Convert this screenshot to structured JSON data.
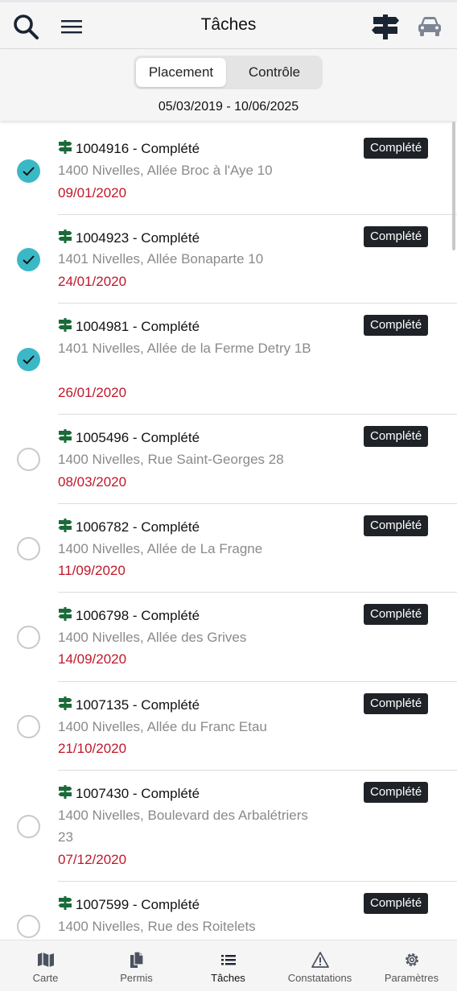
{
  "header": {
    "title": "Tâches"
  },
  "segment": {
    "options": [
      "Placement",
      "Contrôle"
    ],
    "selected": "Placement"
  },
  "date_range": "05/03/2019 - 10/06/2025",
  "tasks": [
    {
      "title": "1004916 - Complété",
      "address": "1400 Nivelles, Allée Broc à l'Aye 10",
      "date": "09/01/2020",
      "badge": "Complété",
      "checked": true
    },
    {
      "title": "1004923 - Complété",
      "address": "1401 Nivelles, Allée Bonaparte 10",
      "date": "24/01/2020",
      "badge": "Complété",
      "checked": true
    },
    {
      "title": "1004981 - Complété",
      "address": "1401 Nivelles, Allée de la Ferme Detry 1B",
      "date": "26/01/2020",
      "badge": "Complété",
      "checked": true
    },
    {
      "title": "1005496 - Complété",
      "address": "1400 Nivelles, Rue Saint-Georges 28",
      "date": "08/03/2020",
      "badge": "Complété",
      "checked": false
    },
    {
      "title": "1006782 - Complété",
      "address": "1400 Nivelles, Allée de La Fragne",
      "date": "11/09/2020",
      "badge": "Complété",
      "checked": false
    },
    {
      "title": "1006798 - Complété",
      "address": "1400 Nivelles, Allée des Grives",
      "date": "14/09/2020",
      "badge": "Complété",
      "checked": false
    },
    {
      "title": "1007135 - Complété",
      "address": "1400 Nivelles, Allée du Franc Etau",
      "date": "21/10/2020",
      "badge": "Complété",
      "checked": false
    },
    {
      "title": "1007430 - Complété",
      "address": "1400 Nivelles, Boulevard des Arbalétriers 23",
      "date": "07/12/2020",
      "badge": "Complété",
      "checked": false
    },
    {
      "title": "1007599 - Complété",
      "address": "1400 Nivelles, Rue des Roitelets",
      "date": "",
      "badge": "Complété",
      "checked": false
    }
  ],
  "tabs": [
    {
      "label": "Carte",
      "icon": "map-icon"
    },
    {
      "label": "Permis",
      "icon": "documents-icon"
    },
    {
      "label": "Tâches",
      "icon": "list-icon",
      "active": true
    },
    {
      "label": "Constatations",
      "icon": "warning-icon"
    },
    {
      "label": "Paramètres",
      "icon": "gear-icon"
    }
  ],
  "colors": {
    "accent": "#3bb8c6",
    "date": "#c0172a",
    "sign_green": "#1b6b3a",
    "badge_bg": "#1f2328"
  }
}
